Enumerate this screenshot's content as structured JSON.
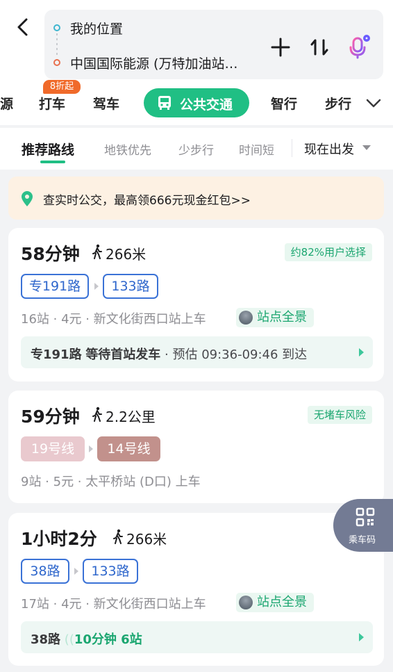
{
  "search": {
    "origin": "我的位置",
    "destination": "中国国际能源 (万特加油站…"
  },
  "modes": {
    "partial_left": "源",
    "taxi": "打车",
    "taxi_badge": "8折起",
    "drive": "驾车",
    "transit": "公共交通",
    "smart": "智行",
    "walk": "步行"
  },
  "tabs": {
    "recommended": "推荐路线",
    "subway_first": "地铁优先",
    "less_walking": "少步行",
    "shortest_time": "时间短",
    "depart_now": "现在出发"
  },
  "promo": {
    "text": "查实时公交，最高领666元现金红包>>"
  },
  "routes": [
    {
      "duration": "58分钟",
      "walk": "266米",
      "tag": "约82%用户选择",
      "lines": [
        "专191路",
        "133路"
      ],
      "meta": "16站 · 4元 · 新文化街西口站上车",
      "panorama": "站点全景",
      "info_line": "专191路",
      "info_status": "等待首站发车",
      "info_eta": "· 预估 09:36-09:46 到达"
    },
    {
      "duration": "59分钟",
      "walk": "2.2公里",
      "tag": "无堵车风险",
      "lines": [
        "19号线",
        "14号线"
      ],
      "meta": "9站 · 5元 · 太平桥站 (D口) 上车"
    },
    {
      "duration": "1小时2分",
      "walk": "266米",
      "lines": [
        "38路",
        "133路"
      ],
      "meta": "17站 · 4元 · 新文化街西口站上车",
      "panorama": "站点全景",
      "info_line": "38路",
      "info_status": "10分钟 6站"
    }
  ],
  "qr": {
    "label": "乘车码"
  },
  "colors": {
    "accent": "#20bf84",
    "bus_line": "#2f67cc",
    "line19": "#e9c9ce",
    "line14": "#c2918c",
    "badge": "#f06a2a",
    "promo_bg": "#fdf1e3"
  }
}
